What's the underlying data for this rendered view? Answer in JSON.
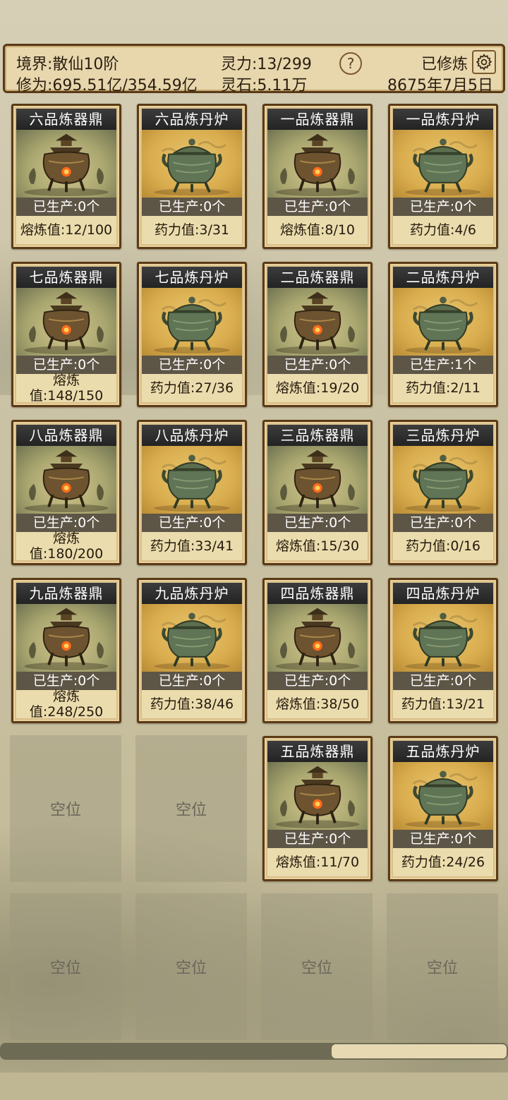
{
  "header": {
    "realm": "境界:散仙10阶",
    "spirit_power": "灵力:13/299",
    "help_label": "?",
    "cultivated": "已修炼",
    "cultivation": "修为:695.51亿/354.59亿",
    "spirit_stone": "灵石:5.11万",
    "date": "8675年7月5日"
  },
  "cards": [
    {
      "title": "六品炼器鼎",
      "kind": "ding",
      "produced": "已生产:0个",
      "stat": "熔炼值:12/100"
    },
    {
      "title": "六品炼丹炉",
      "kind": "lu",
      "produced": "已生产:0个",
      "stat": "药力值:3/31"
    },
    {
      "title": "一品炼器鼎",
      "kind": "ding",
      "produced": "已生产:0个",
      "stat": "熔炼值:8/10"
    },
    {
      "title": "一品炼丹炉",
      "kind": "lu",
      "produced": "已生产:0个",
      "stat": "药力值:4/6"
    },
    {
      "title": "七品炼器鼎",
      "kind": "ding",
      "produced": "已生产:0个",
      "stat": "熔炼值:148/150"
    },
    {
      "title": "七品炼丹炉",
      "kind": "lu",
      "produced": "已生产:0个",
      "stat": "药力值:27/36"
    },
    {
      "title": "二品炼器鼎",
      "kind": "ding",
      "produced": "已生产:0个",
      "stat": "熔炼值:19/20"
    },
    {
      "title": "二品炼丹炉",
      "kind": "lu",
      "produced": "已生产:1个",
      "stat": "药力值:2/11"
    },
    {
      "title": "八品炼器鼎",
      "kind": "ding",
      "produced": "已生产:0个",
      "stat": "熔炼值:180/200"
    },
    {
      "title": "八品炼丹炉",
      "kind": "lu",
      "produced": "已生产:0个",
      "stat": "药力值:33/41"
    },
    {
      "title": "三品炼器鼎",
      "kind": "ding",
      "produced": "已生产:0个",
      "stat": "熔炼值:15/30"
    },
    {
      "title": "三品炼丹炉",
      "kind": "lu",
      "produced": "已生产:0个",
      "stat": "药力值:0/16"
    },
    {
      "title": "九品炼器鼎",
      "kind": "ding",
      "produced": "已生产:0个",
      "stat": "熔炼值:248/250"
    },
    {
      "title": "九品炼丹炉",
      "kind": "lu",
      "produced": "已生产:0个",
      "stat": "药力值:38/46"
    },
    {
      "title": "四品炼器鼎",
      "kind": "ding",
      "produced": "已生产:0个",
      "stat": "熔炼值:38/50"
    },
    {
      "title": "四品炼丹炉",
      "kind": "lu",
      "produced": "已生产:0个",
      "stat": "药力值:13/21"
    },
    {
      "title": "五品炼器鼎",
      "kind": "ding",
      "produced": "已生产:0个",
      "stat": "熔炼值:11/70"
    },
    {
      "title": "五品炼丹炉",
      "kind": "lu",
      "produced": "已生产:0个",
      "stat": "药力值:24/26"
    }
  ],
  "empty_label": "空位",
  "empty_slot_count": 6,
  "icons": {
    "settings": "gear-icon",
    "help": "question-icon"
  },
  "scroll_position": 0.65
}
